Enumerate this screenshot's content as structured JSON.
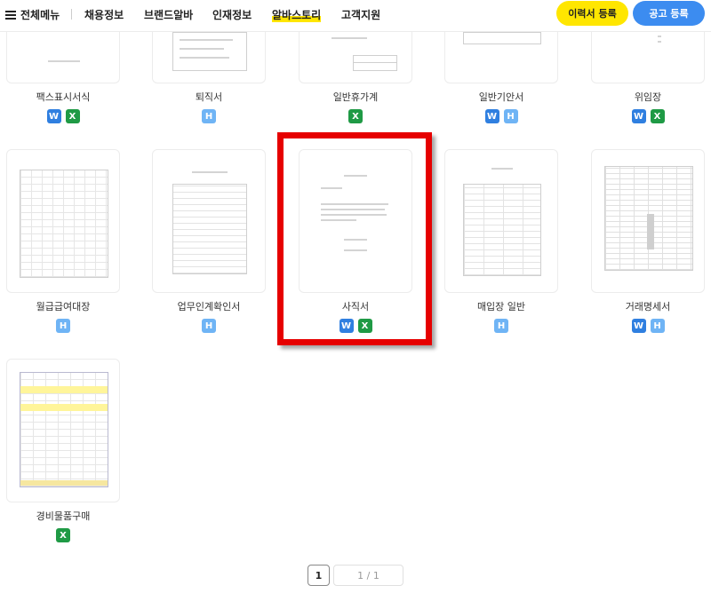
{
  "header": {
    "menu_label": "전체메뉴",
    "nav": [
      "채용정보",
      "브랜드알바",
      "인재정보",
      "알바스토리",
      "고객지원"
    ],
    "active_nav": "알바스토리",
    "resume_button": "이력서 등록",
    "post_button": "공고 등록"
  },
  "forms": [
    {
      "name": "팩스표시서식",
      "formats": [
        "W",
        "X"
      ]
    },
    {
      "name": "퇴직서",
      "formats": [
        "H"
      ]
    },
    {
      "name": "일반휴가계",
      "formats": [
        "X"
      ]
    },
    {
      "name": "일반기안서",
      "formats": [
        "W",
        "H"
      ]
    },
    {
      "name": "위임장",
      "formats": [
        "W",
        "X"
      ]
    },
    {
      "name": "월급급여대장",
      "formats": [
        "H"
      ]
    },
    {
      "name": "업무인계확인서",
      "formats": [
        "H"
      ]
    },
    {
      "name": "사직서",
      "formats": [
        "W",
        "X"
      ]
    },
    {
      "name": "매입장 일반",
      "formats": [
        "H"
      ]
    },
    {
      "name": "거래명세서",
      "formats": [
        "W",
        "H"
      ]
    },
    {
      "name": "경비물품구매",
      "formats": [
        "X"
      ]
    }
  ],
  "pagination": {
    "current": "1",
    "info": "1 / 1"
  },
  "colors": {
    "accent_yellow": "#ffe600",
    "accent_blue": "#3c8cf0",
    "highlight_red": "#e60000"
  }
}
